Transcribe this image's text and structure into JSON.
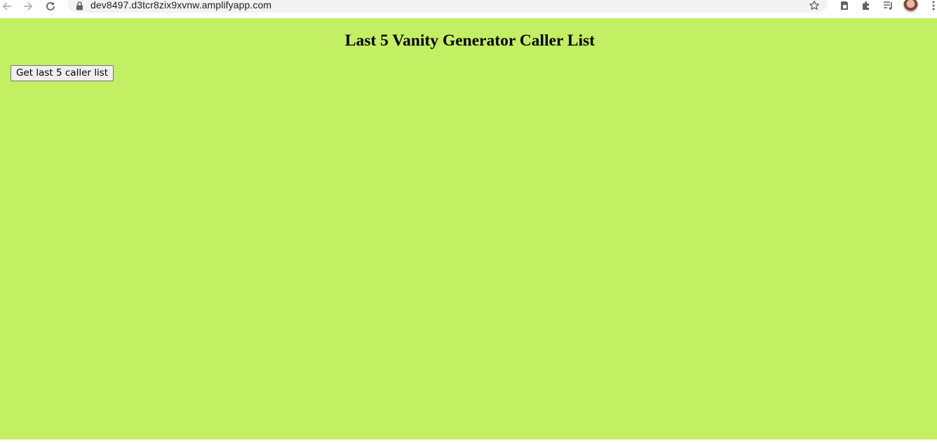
{
  "browser": {
    "url": "dev8497.d3tcr8zix9xvnw.amplifyapp.com",
    "icons": [
      "back-icon",
      "forward-icon",
      "reload-icon",
      "lock-icon",
      "star-icon",
      "extension-icon",
      "puzzle-icon",
      "media-icon",
      "avatar"
    ]
  },
  "page": {
    "background": "#c3ef63",
    "title": "Last 5 Vanity Generator Caller List",
    "button_label": "Get last 5 caller list"
  }
}
